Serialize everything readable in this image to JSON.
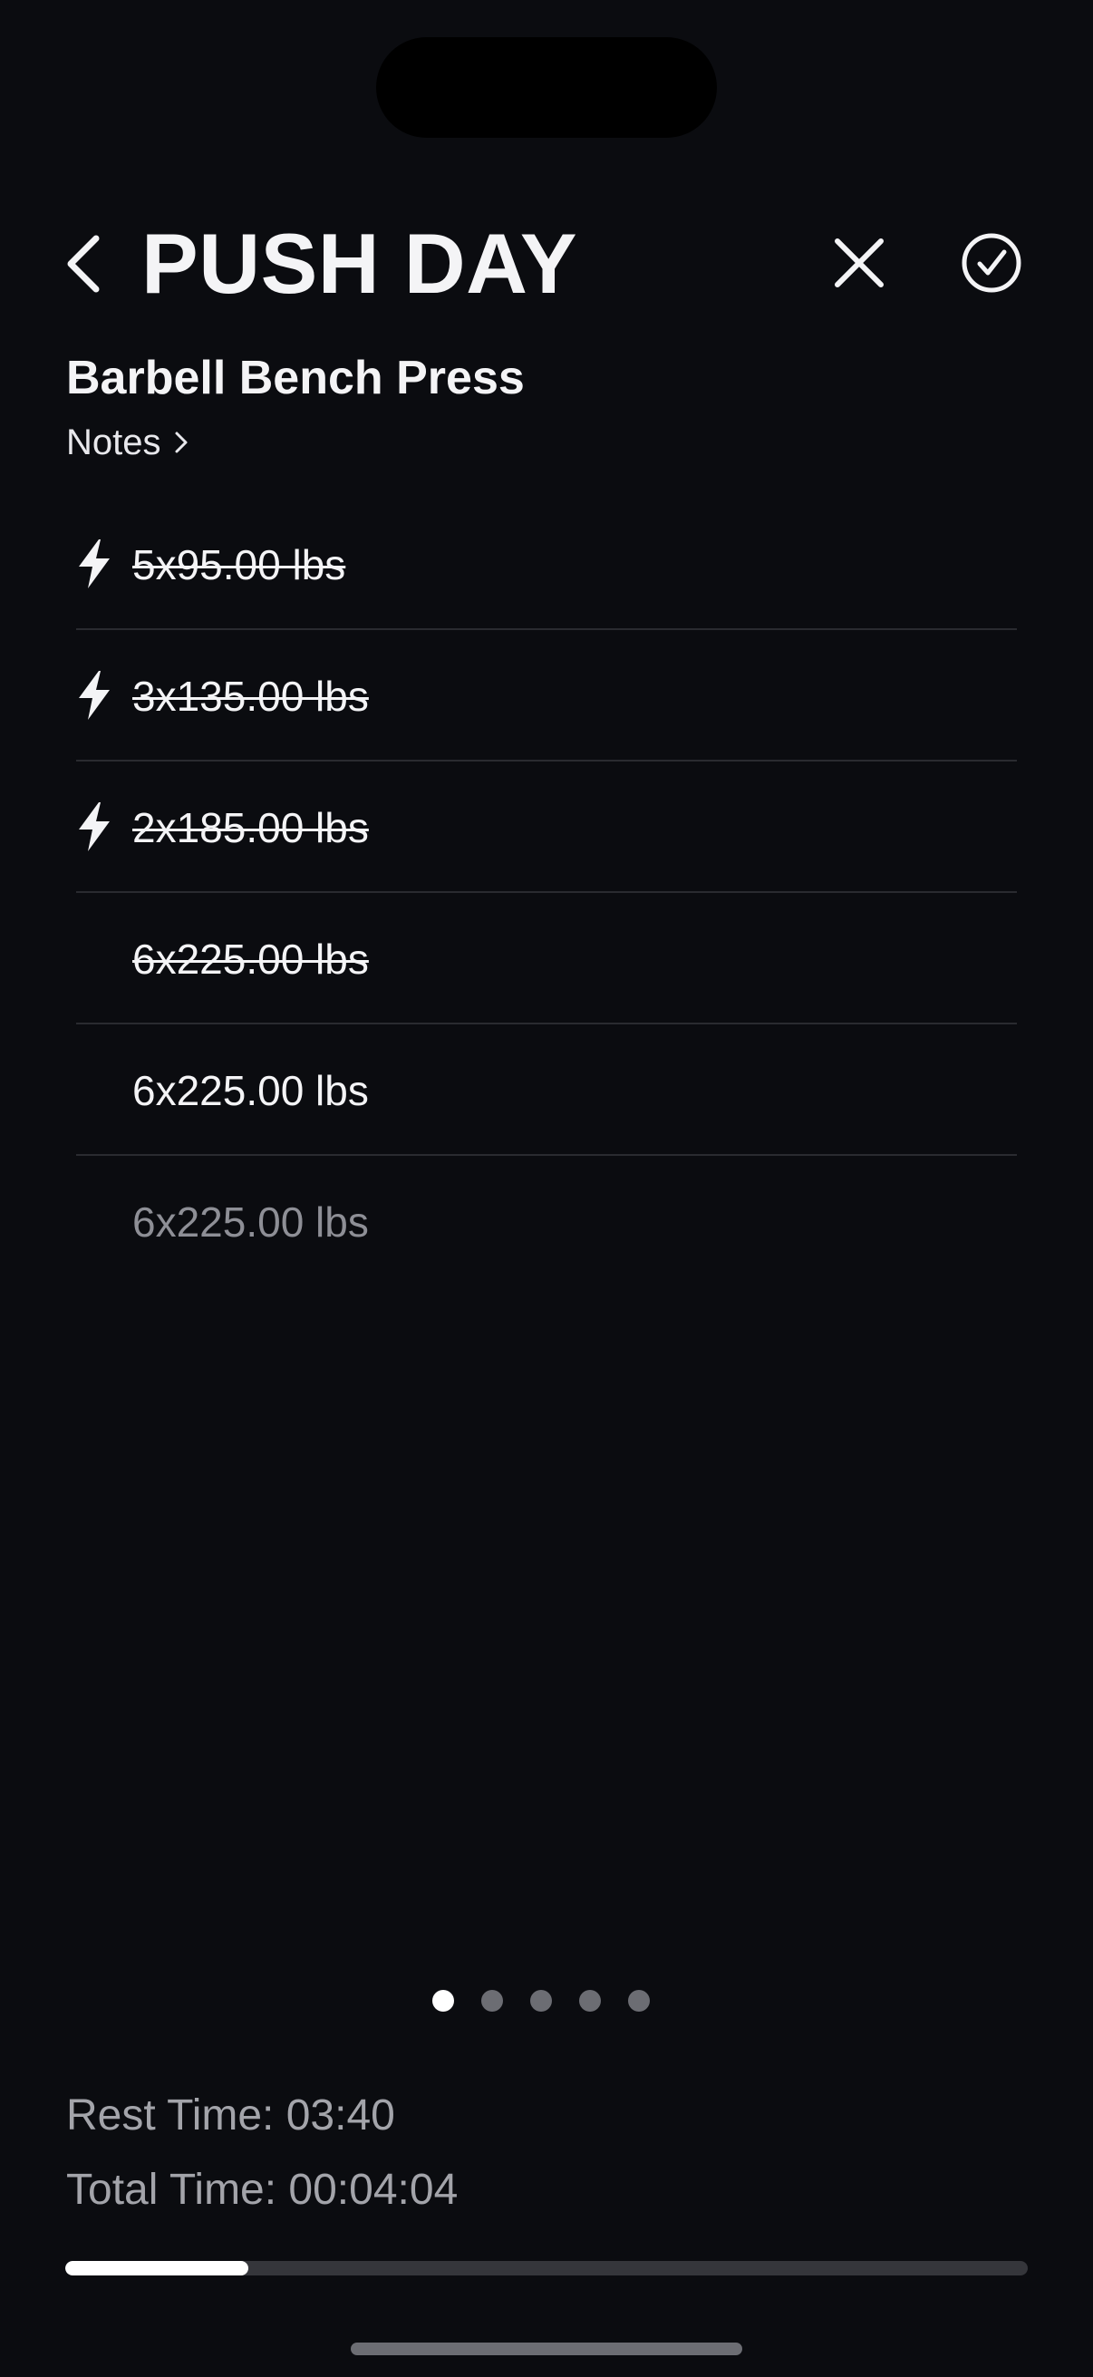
{
  "header": {
    "title": "PUSH DAY"
  },
  "exercise": {
    "name": "Barbell Bench Press",
    "notes_label": "Notes"
  },
  "sets": [
    {
      "label": "5x95.00 lbs",
      "warmup": true,
      "completed": true
    },
    {
      "label": "3x135.00 lbs",
      "warmup": true,
      "completed": true
    },
    {
      "label": "2x185.00 lbs",
      "warmup": true,
      "completed": true
    },
    {
      "label": "6x225.00 lbs",
      "warmup": false,
      "completed": true
    },
    {
      "label": "6x225.00 lbs",
      "warmup": false,
      "completed": false,
      "current": true
    },
    {
      "label": "6x225.00 lbs",
      "warmup": false,
      "completed": false,
      "pending": true
    }
  ],
  "pager": {
    "count": 5,
    "active_index": 0
  },
  "timers": {
    "rest": "Rest Time: 03:40",
    "total": "Total Time: 00:04:04"
  },
  "progress": {
    "fraction": 0.19
  },
  "icons": {
    "back": "chevron-left-icon",
    "close": "close-icon",
    "finish": "check-circle-icon",
    "notes": "chevron-right-icon",
    "warmup": "lightning-bolt-icon"
  },
  "colors": {
    "background": "#0b0c10",
    "text": "#f4f4f6",
    "muted": "#a3a4aa",
    "divider": "#2a2b30",
    "progress_fill": "#ffffff",
    "progress_track": "#35363b"
  }
}
